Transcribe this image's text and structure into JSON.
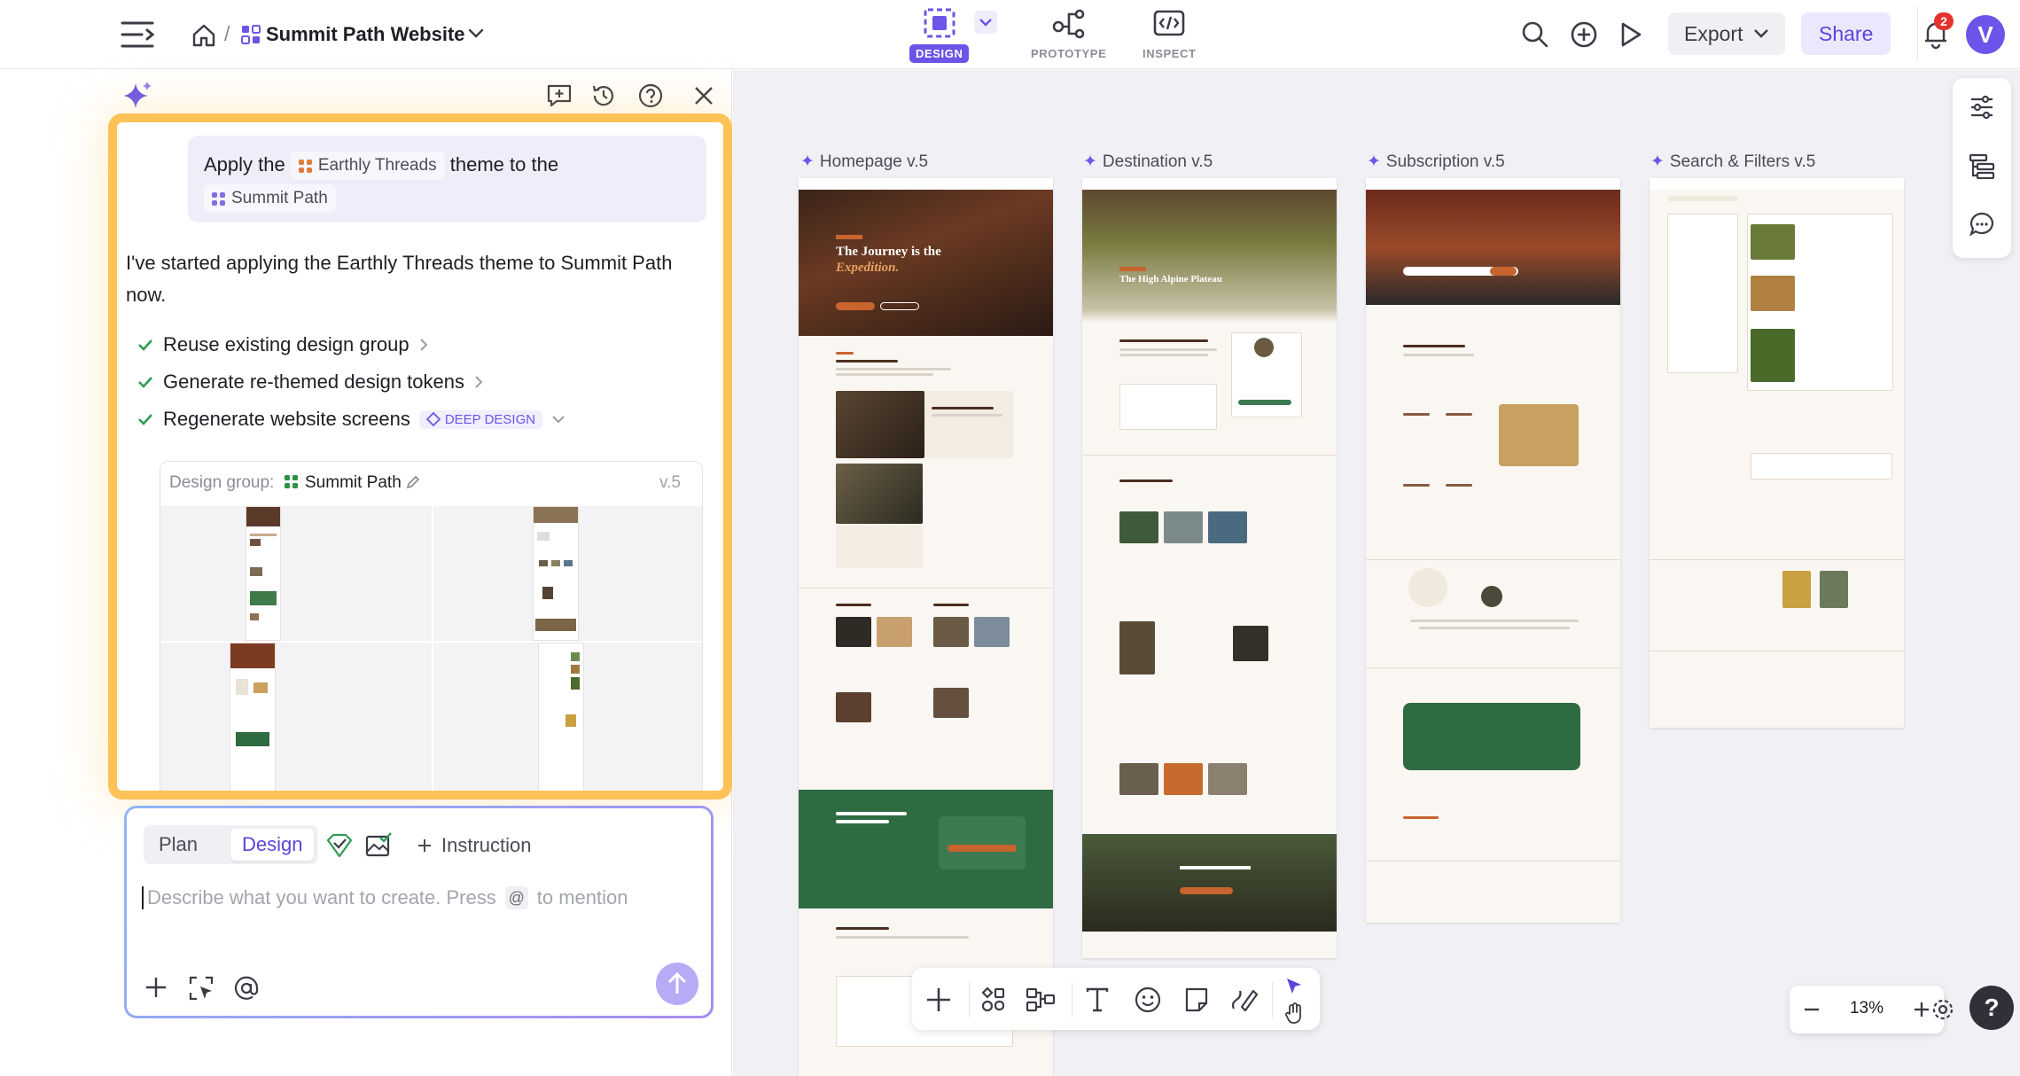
{
  "topbar": {
    "breadcrumb_sep": "/",
    "project_title": "Summit Path Website",
    "tabs": [
      {
        "label": "DESIGN",
        "active": true
      },
      {
        "label": "PROTOTYPE",
        "active": false
      },
      {
        "label": "INSPECT",
        "active": false
      }
    ],
    "export_label": "Export",
    "share_label": "Share",
    "notification_count": "2",
    "avatar_letter": "V",
    "accent": "#6b55e8"
  },
  "chat": {
    "user_message": {
      "part1": "Apply the",
      "theme_name": "Earthly Threads",
      "part2": "theme",
      "part3": "to",
      "part4": "the",
      "target_name": "Summit Path"
    },
    "assistant_message": "I've started applying the Earthly Threads theme to Summit Path now.",
    "steps": [
      {
        "label": "Reuse existing design group"
      },
      {
        "label": "Generate re-themed design tokens"
      },
      {
        "label": "Regenerate website screens",
        "badge": "DEEP DESIGN"
      }
    ],
    "design_group": {
      "prefix": "Design group:",
      "name": "Summit Path",
      "version": "v.5"
    }
  },
  "prompt": {
    "mode_plan": "Plan",
    "mode_design": "Design",
    "instruction_label": "Instruction",
    "placeholder_part1": "Describe what you want to create. Press",
    "mention_key": "@",
    "placeholder_part2": "to mention"
  },
  "canvas": {
    "frames": [
      {
        "label": "Homepage v.5",
        "hero_title": "The Journey is the",
        "hero_italic": "Expedition."
      },
      {
        "label": "Destination v.5",
        "hero_title": "The High Alpine Plateau"
      },
      {
        "label": "Subscription v.5"
      },
      {
        "label": "Search & Filters v.5"
      }
    ]
  },
  "zoom": {
    "level": "13%"
  },
  "help_label": "?"
}
